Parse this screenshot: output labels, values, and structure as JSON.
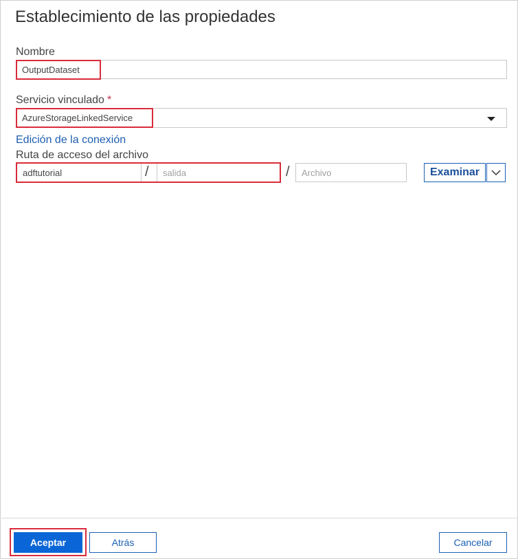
{
  "panel": {
    "title": "Establecimiento de las propiedades"
  },
  "fields": {
    "name_label": "Nombre",
    "name_value": "OutputDataset",
    "linked_service_label": "Servicio vinculado",
    "required_mark": "*",
    "linked_service_value": "AzureStorageLinkedService",
    "edit_connection_link": "Edición de la conexión",
    "file_path_label": "Ruta de acceso del archivo",
    "container_value": "adftutorial",
    "folder_placeholder": "salida",
    "file_placeholder": "Archivo",
    "path_separator": "/",
    "browse_label": "Examinar"
  },
  "footer": {
    "ok_label": "Aceptar",
    "back_label": "Atrás",
    "cancel_label": "Cancelar"
  },
  "colors": {
    "accent": "#0a66d6",
    "highlight": "#d92b3a",
    "link": "#1f5fb0"
  }
}
